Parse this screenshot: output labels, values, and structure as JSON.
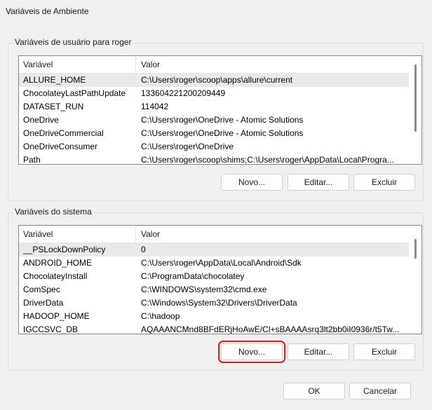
{
  "window": {
    "title": "Variáveis de Ambiente"
  },
  "user_section": {
    "label": "Variáveis de usuário para roger",
    "columns": [
      "Variável",
      "Valor"
    ],
    "rows": [
      {
        "name": "ALLURE_HOME",
        "value": "C:\\Users\\roger\\scoop\\apps\\allure\\current"
      },
      {
        "name": "ChocolateyLastPathUpdate",
        "value": "133604221200209449"
      },
      {
        "name": "DATASET_RUN",
        "value": "114042"
      },
      {
        "name": "OneDrive",
        "value": "C:\\Users\\roger\\OneDrive - Atomic Solutions"
      },
      {
        "name": "OneDriveCommercial",
        "value": "C:\\Users\\roger\\OneDrive - Atomic Solutions"
      },
      {
        "name": "OneDriveConsumer",
        "value": "C:\\Users\\roger\\OneDrive"
      },
      {
        "name": "Path",
        "value": "C:\\Users\\roger\\scoop\\shims;C:\\Users\\roger\\AppData\\Local\\Progra..."
      }
    ],
    "buttons": {
      "new": "Novo...",
      "edit": "Editar...",
      "delete": "Excluir"
    }
  },
  "system_section": {
    "label": "Variáveis do sistema",
    "columns": [
      "Variável",
      "Valor"
    ],
    "rows": [
      {
        "name": "__PSLockDownPolicy",
        "value": "0"
      },
      {
        "name": "ANDROID_HOME",
        "value": "C:\\Users\\roger\\AppData\\Local\\Android\\Sdk"
      },
      {
        "name": "ChocolateyInstall",
        "value": "C:\\ProgramData\\chocolatey"
      },
      {
        "name": "ComSpec",
        "value": "C:\\WINDOWS\\system32\\cmd.exe"
      },
      {
        "name": "DriverData",
        "value": "C:\\Windows\\System32\\Drivers\\DriverData"
      },
      {
        "name": "HADOOP_HOME",
        "value": "C:\\hadoop"
      },
      {
        "name": "IGCCSVC_DB",
        "value": "AQAAANCMnd8BFdERjHoAwE/Cl+sBAAAAsrq3lt2bb0iI0936r/t5Tw..."
      }
    ],
    "buttons": {
      "new": "Novo...",
      "edit": "Editar...",
      "delete": "Excluir"
    }
  },
  "footer": {
    "ok": "OK",
    "cancel": "Cancelar"
  }
}
